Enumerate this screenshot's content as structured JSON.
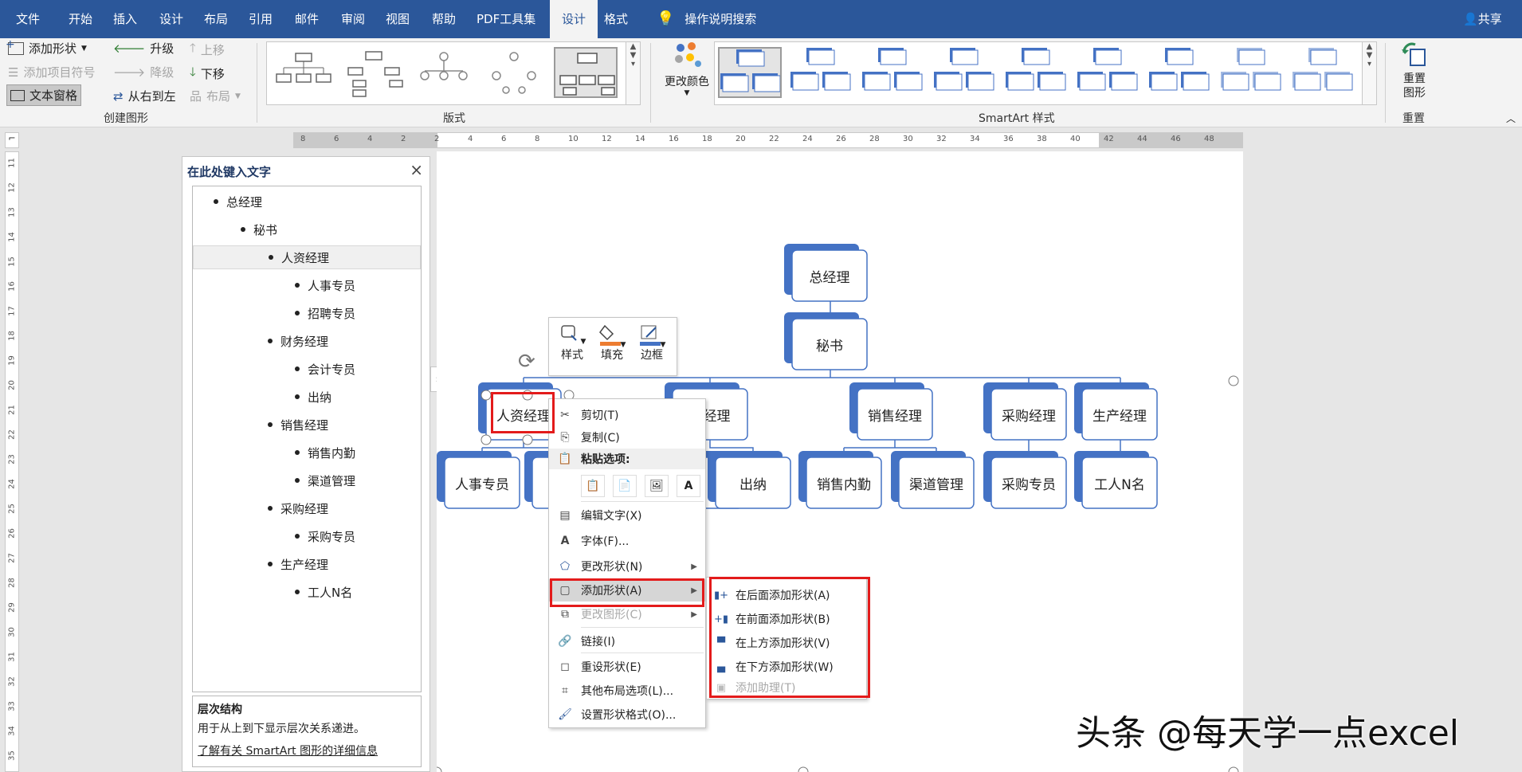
{
  "tabs": [
    "文件",
    "开始",
    "插入",
    "设计",
    "布局",
    "引用",
    "邮件",
    "审阅",
    "视图",
    "帮助",
    "PDF工具集",
    "设计",
    "格式"
  ],
  "active_tab_index": 11,
  "tell_me": "操作说明搜索",
  "share": "共享",
  "ribbon": {
    "create": {
      "add_shape": "添加形状",
      "add_bullet": "添加项目符号",
      "text_pane": "文本窗格",
      "promote": "升级",
      "demote": "降级",
      "rtl": "从右到左",
      "move_up": "上移",
      "move_down": "下移",
      "layout": "布局",
      "group": "创建图形"
    },
    "layouts_group": "版式",
    "change_colors": "更改颜色",
    "styles_group": "SmartArt 样式",
    "reset_graphic": "重置图形",
    "reset_group": "重置"
  },
  "ruler": {
    "h_labels": [
      "8",
      "6",
      "4",
      "2",
      "2",
      "4",
      "6",
      "8",
      "10",
      "12",
      "14",
      "16",
      "18",
      "20",
      "22",
      "24",
      "26",
      "28",
      "30",
      "32",
      "34",
      "36",
      "38",
      "40",
      "42",
      "44",
      "46",
      "48"
    ],
    "v_labels": [
      "11",
      "12",
      "13",
      "14",
      "15",
      "16",
      "17",
      "18",
      "19",
      "20",
      "21",
      "22",
      "23",
      "24",
      "25",
      "26",
      "27",
      "28",
      "29",
      "30",
      "31",
      "32",
      "33",
      "34",
      "35"
    ]
  },
  "text_pane": {
    "title": "在此处键入文字",
    "close": "×",
    "items": [
      {
        "text": "总经理",
        "level": 0
      },
      {
        "text": "秘书",
        "level": 1
      },
      {
        "text": "人资经理",
        "level": 2
      },
      {
        "text": "人事专员",
        "level": 3
      },
      {
        "text": "招聘专员",
        "level": 3
      },
      {
        "text": "财务经理",
        "level": 2
      },
      {
        "text": "会计专员",
        "level": 3
      },
      {
        "text": "出纳",
        "level": 3
      },
      {
        "text": "销售经理",
        "level": 2
      },
      {
        "text": "销售内勤",
        "level": 3
      },
      {
        "text": "渠道管理",
        "level": 3
      },
      {
        "text": "采购经理",
        "level": 2
      },
      {
        "text": "采购专员",
        "level": 3
      },
      {
        "text": "生产经理",
        "level": 2
      },
      {
        "text": "工人N名",
        "level": 3
      }
    ],
    "selected_index": 2,
    "info_title": "层次结构",
    "info_desc": "用于从上到下显示层次关系递进。",
    "info_link": "了解有关 SmartArt 图形的详细信息"
  },
  "org_chart": {
    "top": "总经理",
    "secretary": "秘书",
    "managers": [
      "人资经理",
      "务经理",
      "销售经理",
      "采购经理",
      "生产经理"
    ],
    "staff": [
      "人事专员",
      "出纳",
      "销售内勤",
      "渠道管理",
      "采购专员",
      "工人N名"
    ]
  },
  "mini_toolbar": {
    "style": "样式",
    "fill": "填充",
    "outline": "边框"
  },
  "fill_color": "#ed7d31",
  "outline_color": "#4472c4",
  "context_menu": {
    "cut": "剪切(T)",
    "copy": "复制(C)",
    "paste_options": "粘贴选项:",
    "edit_text": "编辑文字(X)",
    "font": "字体(F)...",
    "change_shape": "更改形状(N)",
    "add_shape": "添加形状(A)",
    "change_graphic": "更改图形(C)",
    "link": "链接(I)",
    "reset_shape": "重设形状(E)",
    "more_layout": "其他布局选项(L)...",
    "format_shape": "设置形状格式(O)..."
  },
  "submenu": {
    "after": "在后面添加形状(A)",
    "before": "在前面添加形状(B)",
    "above": "在上方添加形状(V)",
    "below": "在下方添加形状(W)",
    "assistant": "添加助理(T)"
  },
  "watermark": "头条 @每天学一点excel",
  "colors": {
    "brand": "#2b579a",
    "shape": "#4472c4",
    "highlight": "#e31b1b"
  }
}
